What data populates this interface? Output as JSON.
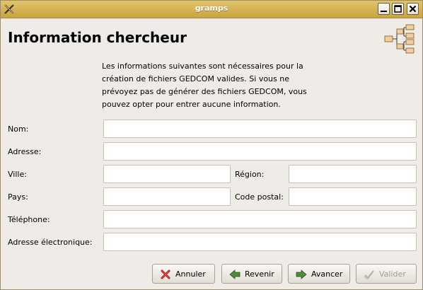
{
  "window": {
    "title": "gramps"
  },
  "header": {
    "title": "Information chercheur"
  },
  "intro": [
    "Les informations suivantes sont nécessaires pour la",
    "création de fichiers GEDCOM valides. Si vous ne",
    "prévoyez pas de générer des fichiers GEDCOM, vous",
    "pouvez opter pour entrer aucune information."
  ],
  "form": {
    "name_label": "Nom:",
    "address_label": "Adresse:",
    "city_label": "Ville:",
    "region_label": "Région:",
    "country_label": "Pays:",
    "postal_label": "Code postal:",
    "phone_label": "Téléphone:",
    "email_label": "Adresse électronique:",
    "name_value": "",
    "address_value": "",
    "city_value": "",
    "region_value": "",
    "country_value": "",
    "postal_value": "",
    "phone_value": "",
    "email_value": ""
  },
  "buttons": {
    "cancel": "Annuler",
    "back": "Revenir",
    "forward": "Avancer",
    "apply": "Valider"
  },
  "icons": {
    "app": "gramps-x-icon",
    "minimize": "minimize-icon",
    "maximize": "maximize-icon",
    "close": "close-icon",
    "header": "family-tree-icon"
  }
}
